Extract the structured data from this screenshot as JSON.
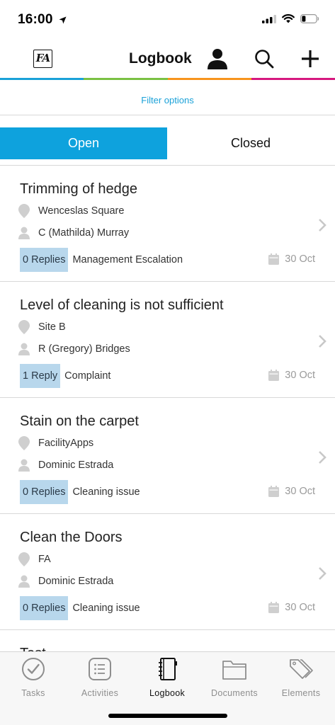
{
  "status_bar": {
    "time": "16:00"
  },
  "header": {
    "logo_text": "FA",
    "title": "Logbook"
  },
  "rainbow_colors": [
    "#1aa1d8",
    "#7ac143",
    "#f7941d",
    "#d6187f"
  ],
  "filter_label": "Filter options",
  "segments": {
    "open": "Open",
    "closed": "Closed",
    "selected": "Open"
  },
  "entries": [
    {
      "title": "Trimming of hedge",
      "location": "Wenceslas Square",
      "user": "C (Mathilda) Murray",
      "replies": "0 Replies",
      "category": "Management Escalation",
      "date": "30 Oct"
    },
    {
      "title": "Level of cleaning is not sufficient",
      "location": "Site B",
      "user": "R (Gregory) Bridges",
      "replies": "1 Reply",
      "category": "Complaint",
      "date": "30 Oct"
    },
    {
      "title": "Stain on the carpet",
      "location": "FacilityApps",
      "user": "Dominic Estrada",
      "replies": "0 Replies",
      "category": "Cleaning issue",
      "date": "30 Oct"
    },
    {
      "title": "Clean the Doors",
      "location": "FA",
      "user": "Dominic Estrada",
      "replies": "0 Replies",
      "category": "Cleaning issue",
      "date": "30 Oct"
    },
    {
      "title": "Test",
      "location": "",
      "user": "",
      "replies": "",
      "category": "",
      "date": ""
    }
  ],
  "tabs": [
    {
      "label": "Tasks",
      "icon": "check-circle-icon"
    },
    {
      "label": "Activities",
      "icon": "list-icon"
    },
    {
      "label": "Logbook",
      "icon": "notebook-icon"
    },
    {
      "label": "Documents",
      "icon": "folder-icon"
    },
    {
      "label": "Elements",
      "icon": "tags-icon"
    }
  ],
  "active_tab": "Logbook"
}
